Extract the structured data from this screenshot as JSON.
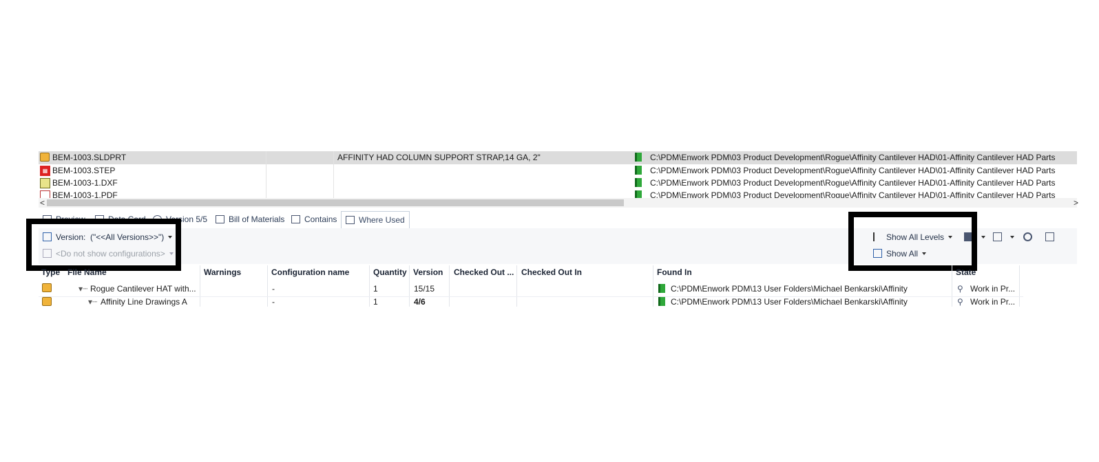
{
  "files": [
    {
      "name": "BEM-1003.SLDPRT",
      "description": "AFFINITY HAD COLUMN SUPPORT STRAP,14 GA, 2\"",
      "path": "C:\\PDM\\Enwork PDM\\03 Product Development\\Rogue\\Affinity Cantilever HAD\\01-Affinity Cantilever HAD Parts",
      "icon": "sldprt-icon",
      "selected": true
    },
    {
      "name": "BEM-1003.STEP",
      "description": "",
      "path": "C:\\PDM\\Enwork PDM\\03 Product Development\\Rogue\\Affinity Cantilever HAD\\01-Affinity Cantilever HAD Parts",
      "icon": "step-icon"
    },
    {
      "name": "BEM-1003-1.DXF",
      "description": "",
      "path": "C:\\PDM\\Enwork PDM\\03 Product Development\\Rogue\\Affinity Cantilever HAD\\01-Affinity Cantilever HAD Parts",
      "icon": "dxf-icon"
    },
    {
      "name": "BEM-1003-1.PDF",
      "description": "",
      "path": "C:\\PDM\\Enwork PDM\\03 Product Development\\Rogue\\Affinity Cantilever HAD\\01-Affinity Cantilever HAD Parts",
      "icon": "pdf-icon"
    }
  ],
  "scroll": {
    "left": "<",
    "right": ">"
  },
  "tabs": [
    "Preview",
    "Data Card",
    "Version 5/5",
    "Bill of Materials",
    "Contains",
    "Where Used"
  ],
  "active_tab": "Where Used",
  "toolbar": {
    "version_label": "Version:",
    "version_value": "(\"<<All Versions>>\")",
    "config_placeholder": "<Do not show configurations>",
    "show_levels": "Show All Levels",
    "show_all": "Show All"
  },
  "grid": {
    "columns": [
      "Type",
      "File Name",
      "Warnings",
      "Configuration name",
      "Quantity",
      "Version",
      "Checked Out ...",
      "Checked Out In",
      "Found In",
      "State"
    ],
    "rows": [
      {
        "file": "Rogue Cantilever HAT with...",
        "warnings": "",
        "config": "-",
        "qty": "1",
        "version": "15/15",
        "checked_out": "",
        "checked_in": "",
        "found": "C:\\PDM\\Enwork PDM\\13 User Folders\\Michael Benkarski\\Affinity",
        "state": "Work in Pr..."
      },
      {
        "file": "Affinity Line Drawings A",
        "warnings": "",
        "config": "-",
        "qty": "1",
        "version": "4/6",
        "checked_out": "",
        "checked_in": "",
        "found": "C:\\PDM\\Enwork PDM\\13 User Folders\\Michael Benkarski\\Affinity",
        "state": "Work in Pr..."
      }
    ]
  },
  "colors": {
    "selected_row": "#dcdcdc",
    "toolbar_bg": "#f6f7f9",
    "highlight_box": "#000000",
    "folder_green": "#2fa83a"
  }
}
